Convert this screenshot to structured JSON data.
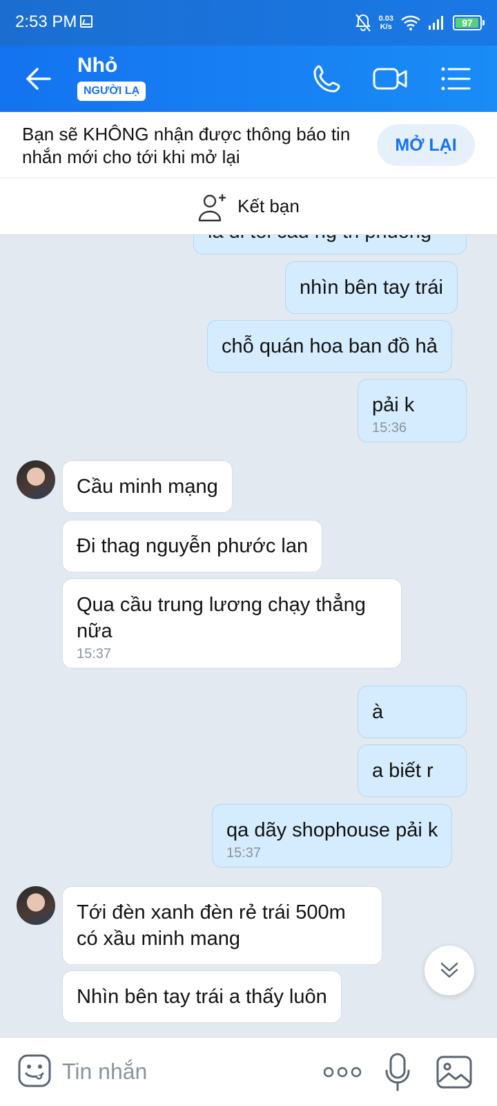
{
  "status_bar": {
    "time": "2:53 PM",
    "net_speed_value": "0.03",
    "net_speed_unit": "K/s",
    "battery": "97",
    "battery_level": 0.97
  },
  "header": {
    "contact_name": "Nhỏ",
    "badge": "NGƯỜI LẠ"
  },
  "notice": {
    "text": "Bạn sẽ KHÔNG nhận được thông báo tin nhắn mới cho tới khi mở lại",
    "button": "MỞ LẠI"
  },
  "add_friend": {
    "label": "Kết bạn"
  },
  "messages": [
    {
      "dir": "out",
      "text": "la di toi cau ng th phuong",
      "time": ""
    },
    {
      "dir": "out",
      "text": "nhìn bên tay trái",
      "time": ""
    },
    {
      "dir": "out",
      "text": "chỗ quán hoa ban đồ hả",
      "time": ""
    },
    {
      "dir": "out",
      "text": "pải k",
      "time": "15:36"
    },
    {
      "dir": "in",
      "text": "Cầu minh mạng",
      "time": ""
    },
    {
      "dir": "in",
      "text": "Đi thag nguyễn phước lan",
      "time": ""
    },
    {
      "dir": "in",
      "text": "Qua cầu trung lương chạy thẳng nữa",
      "time": "15:37"
    },
    {
      "dir": "out",
      "text": "à",
      "time": ""
    },
    {
      "dir": "out",
      "text": "a biết r",
      "time": ""
    },
    {
      "dir": "out",
      "text": "qa dãy shophouse pải k",
      "time": "15:37"
    },
    {
      "dir": "in",
      "text": "Tới đèn xanh đèn rẻ trái 500m có xầu minh mang",
      "time": ""
    },
    {
      "dir": "in",
      "text": "Nhìn bên tay trái a thấy luôn",
      "time": ""
    }
  ],
  "input": {
    "placeholder": "Tin nhắn"
  },
  "colors": {
    "accent": "#1473f0",
    "outgoing_bubble": "#d4ecfd",
    "incoming_bubble": "#ffffff",
    "chat_background": "#e2e9f1"
  },
  "icons": {
    "back": "arrow-left-icon",
    "call": "phone-icon",
    "video": "video-camera-icon",
    "menu": "list-menu-icon",
    "add_friend": "add-person-icon",
    "emoji": "emoji-icon",
    "more": "more-dots-icon",
    "mic": "microphone-icon",
    "image": "image-icon",
    "scroll": "double-chevron-down-icon"
  }
}
